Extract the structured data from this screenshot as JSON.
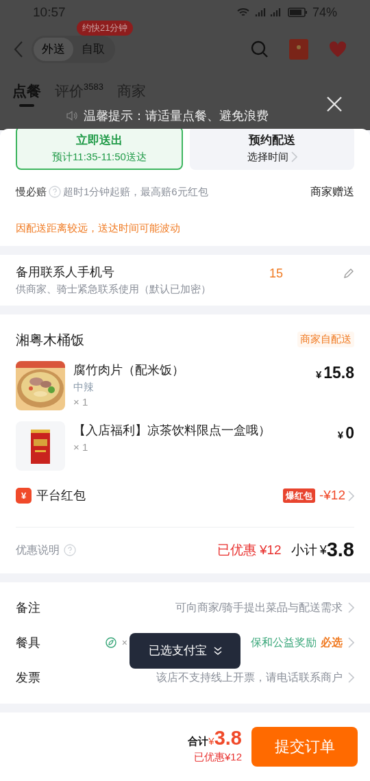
{
  "status_bar": {
    "time": "10:57",
    "battery": "74%"
  },
  "header": {
    "modes": [
      {
        "label": "外送",
        "selected": true
      },
      {
        "label": "自取",
        "selected": false
      }
    ],
    "badge": "约快21分钟"
  },
  "tabs": [
    {
      "label": "点餐",
      "selected": true
    },
    {
      "label": "评价",
      "count": "3583",
      "selected": false
    },
    {
      "label": "商家",
      "selected": false
    }
  ],
  "tip": "温馨提示：请适量点餐、避免浪费",
  "delivery_options": [
    {
      "title": "立即送出",
      "subtitle": "预计11:35-11:50送达",
      "selected": true
    },
    {
      "title": "预约配送",
      "subtitle": "选择时间",
      "selected": false
    }
  ],
  "guarantee": {
    "label": "慢必赔",
    "description": "超时1分钟起赔，最高赔6元红包",
    "note": "商家赠送"
  },
  "warning": "因配送距离较远，送达时间可能波动",
  "contact": {
    "title": "备用联系人手机号",
    "subtitle": "供商家、骑士紧急联系使用（默认已加密）",
    "phone": "15"
  },
  "store": {
    "name": "湘粤木桶饭",
    "tag": "商家自配送",
    "items": [
      {
        "kind": "food",
        "name": "腐竹肉片（配米饭）",
        "spec": "中辣",
        "qty": "× 1",
        "currency": "¥",
        "price": "15.8"
      },
      {
        "kind": "drink",
        "name": "【入店福利】凉茶饮料限点一盒哦）",
        "qty": "× 1",
        "currency": "¥",
        "price": "0"
      }
    ],
    "red_packet": {
      "icon": "¥",
      "label": "平台红包",
      "badge": "爆红包",
      "amount": "-¥12"
    },
    "summary": {
      "label": "优惠说明",
      "discount": "已优惠 ¥12",
      "subtotal_label": "小计",
      "currency": "¥",
      "subtotal": "3.8"
    }
  },
  "options": [
    {
      "kind": "text",
      "label": "备注",
      "value": "可向商家/骑手提出菜品与配送需求"
    },
    {
      "kind": "tableware",
      "label": "餐具",
      "x": "×",
      "value": "保和公益奖励",
      "required": "必选"
    },
    {
      "kind": "text",
      "label": "发票",
      "value": "该店不支持线上开票，请电话联系商户"
    }
  ],
  "toast": "已选支付宝",
  "footer": {
    "total_label": "合计",
    "currency": "¥",
    "total": "3.8",
    "discount": "已优惠¥12",
    "submit": "提交订单"
  }
}
